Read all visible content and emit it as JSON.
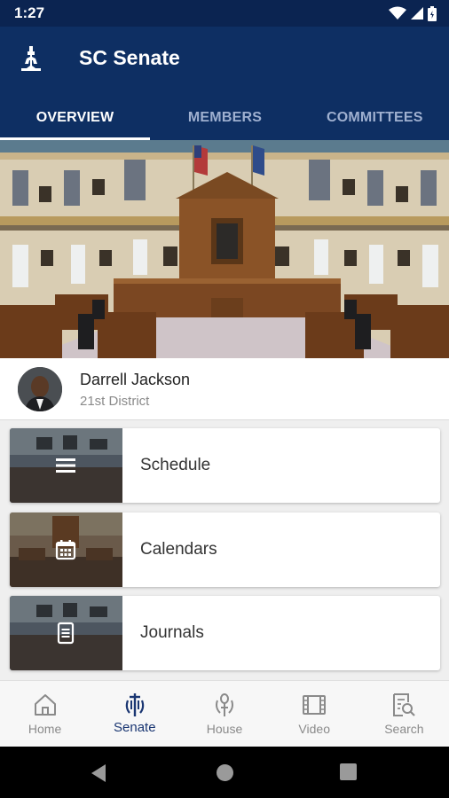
{
  "status_bar": {
    "time": "1:27",
    "icons": [
      "wifi-icon",
      "signal-icon",
      "battery-icon"
    ]
  },
  "app": {
    "title": "SC Senate"
  },
  "tabs": [
    {
      "label": "OVERVIEW",
      "active": true
    },
    {
      "label": "MEMBERS",
      "active": false
    },
    {
      "label": "COMMITTEES",
      "active": false
    }
  ],
  "senator": {
    "name": "Darrell Jackson",
    "district": "21st District"
  },
  "cards": [
    {
      "label": "Schedule",
      "icon": "list-icon"
    },
    {
      "label": "Calendars",
      "icon": "calendar-icon"
    },
    {
      "label": "Journals",
      "icon": "document-icon"
    }
  ],
  "bottom_nav": [
    {
      "label": "Home",
      "icon": "home-icon",
      "active": false
    },
    {
      "label": "Senate",
      "icon": "senate-icon",
      "active": true
    },
    {
      "label": "House",
      "icon": "house-icon",
      "active": false
    },
    {
      "label": "Video",
      "icon": "video-icon",
      "active": false
    },
    {
      "label": "Search",
      "icon": "search-icon",
      "active": false
    }
  ],
  "colors": {
    "primary": "#0e2f63",
    "status_bar": "#0b2451",
    "active_nav": "#1a3672"
  }
}
